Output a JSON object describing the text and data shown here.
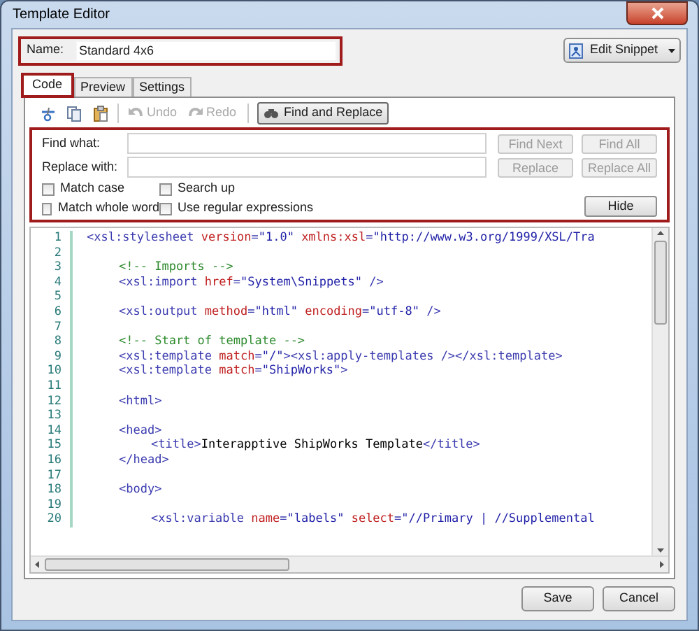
{
  "window": {
    "title": "Template Editor"
  },
  "name_field": {
    "label": "Name:",
    "value": "Standard 4x6"
  },
  "edit_snippet_button": {
    "label": "Edit Snippet"
  },
  "tabs": [
    {
      "label": "Code",
      "selected": true
    },
    {
      "label": "Preview",
      "selected": false
    },
    {
      "label": "Settings",
      "selected": false
    }
  ],
  "toolbar": [
    {
      "kind": "icon",
      "disabled": false
    },
    {
      "kind": "icon",
      "disabled": false
    },
    {
      "kind": "icon",
      "disabled": false
    },
    {
      "kind": "button",
      "label": "Undo",
      "disabled": true
    },
    {
      "kind": "button",
      "label": "Redo",
      "disabled": true
    },
    {
      "kind": "toggle",
      "label": "Find and Replace",
      "selected": true
    }
  ],
  "find_panel": {
    "find_label": "Find what:",
    "replace_label": "Replace with:",
    "buttons": [
      {
        "label": "Find Next",
        "disabled": true
      },
      {
        "label": "Find All",
        "disabled": true
      },
      {
        "label": "Replace",
        "disabled": true
      },
      {
        "label": "Replace All",
        "disabled": true
      }
    ],
    "options": [
      {
        "label": "Match case",
        "checked": false
      },
      {
        "label": "Search up",
        "checked": false
      },
      {
        "label": "Match whole word",
        "checked": false
      },
      {
        "label": "Use regular expressions",
        "checked": false
      }
    ],
    "hide_button": {
      "label": "Hide"
    }
  },
  "code_lines": [
    {
      "number": "1",
      "tokens": [
        {
          "kind": "tag",
          "text": "<xsl:stylesheet "
        },
        {
          "kind": "attr",
          "text": "version"
        },
        {
          "kind": "tag",
          "text": "="
        },
        {
          "kind": "value",
          "text": "\"1.0\" "
        },
        {
          "kind": "attr",
          "text": "xmlns:xsl"
        },
        {
          "kind": "tag",
          "text": "="
        },
        {
          "kind": "value",
          "text": "\"http://www.w3.org/1999/XSL/Tra"
        }
      ],
      "children": [
        {
          "number": "2"
        },
        {
          "number": "3",
          "tokens": [
            {
              "kind": "comment",
              "text": "<!-- Imports -->"
            }
          ]
        },
        {
          "number": "4",
          "tokens": [
            {
              "kind": "tag",
              "text": "<xsl:import "
            },
            {
              "kind": "attr",
              "text": "href"
            },
            {
              "kind": "tag",
              "text": "="
            },
            {
              "kind": "value",
              "text": "\"System\\Snippets\""
            },
            {
              "kind": "tag",
              "text": " />"
            }
          ]
        },
        {
          "number": "5"
        },
        {
          "number": "6",
          "tokens": [
            {
              "kind": "tag",
              "text": "<xsl:output "
            },
            {
              "kind": "attr",
              "text": "method"
            },
            {
              "kind": "tag",
              "text": "="
            },
            {
              "kind": "value",
              "text": "\"html\" "
            },
            {
              "kind": "attr",
              "text": "encoding"
            },
            {
              "kind": "tag",
              "text": "="
            },
            {
              "kind": "value",
              "text": "\"utf-8\""
            },
            {
              "kind": "tag",
              "text": " />"
            }
          ]
        },
        {
          "number": "7"
        },
        {
          "number": "8",
          "tokens": [
            {
              "kind": "comment",
              "text": "<!-- Start of template -->"
            }
          ]
        },
        {
          "number": "9",
          "tokens": [
            {
              "kind": "tag",
              "text": "<xsl:template "
            },
            {
              "kind": "attr",
              "text": "match"
            },
            {
              "kind": "tag",
              "text": "="
            },
            {
              "kind": "value",
              "text": "\"/\""
            },
            {
              "kind": "tag",
              "text": "><xsl:apply-templates /></xsl:template>"
            }
          ]
        },
        {
          "number": "10",
          "tokens": [
            {
              "kind": "tag",
              "text": "<xsl:template "
            },
            {
              "kind": "attr",
              "text": "match"
            },
            {
              "kind": "tag",
              "text": "="
            },
            {
              "kind": "value",
              "text": "\"ShipWorks\""
            },
            {
              "kind": "tag",
              "text": ">"
            }
          ]
        },
        {
          "number": "11"
        },
        {
          "number": "12",
          "tokens": [
            {
              "kind": "tag",
              "text": "<html>"
            }
          ]
        },
        {
          "number": "13"
        },
        {
          "number": "14",
          "tokens": [
            {
              "kind": "tag",
              "text": "<head>"
            }
          ],
          "children": [
            {
              "number": "15",
              "tokens": [
                {
                  "kind": "tag",
                  "text": "<title>"
                },
                {
                  "kind": "text",
                  "text": "Interapptive ShipWorks Template"
                },
                {
                  "kind": "tag",
                  "text": "</title>"
                }
              ]
            }
          ]
        },
        {
          "number": "16",
          "tokens": [
            {
              "kind": "tag",
              "text": "</head>"
            }
          ]
        },
        {
          "number": "17"
        },
        {
          "number": "18",
          "tokens": [
            {
              "kind": "tag",
              "text": "<body>"
            }
          ],
          "children": [
            {
              "number": "19"
            },
            {
              "number": "20",
              "tokens": [
                {
                  "kind": "tag",
                  "text": "<xsl:variable "
                },
                {
                  "kind": "attr",
                  "text": "name"
                },
                {
                  "kind": "tag",
                  "text": "="
                },
                {
                  "kind": "value",
                  "text": "\"labels\" "
                },
                {
                  "kind": "attr",
                  "text": "select"
                },
                {
                  "kind": "tag",
                  "text": "="
                },
                {
                  "kind": "value",
                  "text": "\"//Primary | //Supplemental"
                }
              ]
            }
          ]
        }
      ]
    }
  ],
  "footer_buttons": [
    {
      "label": "Save"
    },
    {
      "label": "Cancel"
    }
  ]
}
